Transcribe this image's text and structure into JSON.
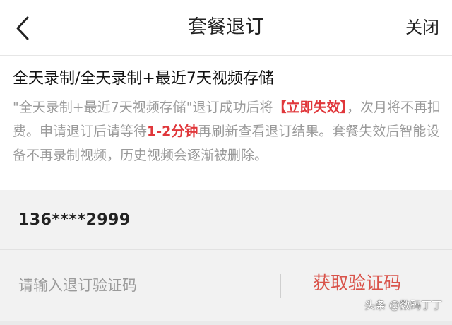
{
  "navbar": {
    "back_icon": "chevron-left-icon",
    "title": "套餐退订",
    "close_label": "关闭"
  },
  "package": {
    "name": "全天录制/全天录制+最近7天视频存储"
  },
  "notice": {
    "part1": "\"全天录制+最近7天视频存储\"退订成功后将",
    "highlight1": "【立即失效】",
    "part2": "，次月将不再扣费。申请退订后请等待",
    "highlight2": "1-2分钟",
    "part3": "再刷新查看退订结果。套餐失效后智能设备不再录制视频，历史视频会逐渐被删除。",
    "highlight_color": "#e0373b"
  },
  "phone": {
    "masked_number": "136****2999"
  },
  "verification": {
    "placeholder": "请输入退订验证码",
    "value": "",
    "get_code_label": "获取验证码",
    "accent_color": "#d9534a"
  },
  "watermark": {
    "text": "头条 @数码丁丁"
  }
}
